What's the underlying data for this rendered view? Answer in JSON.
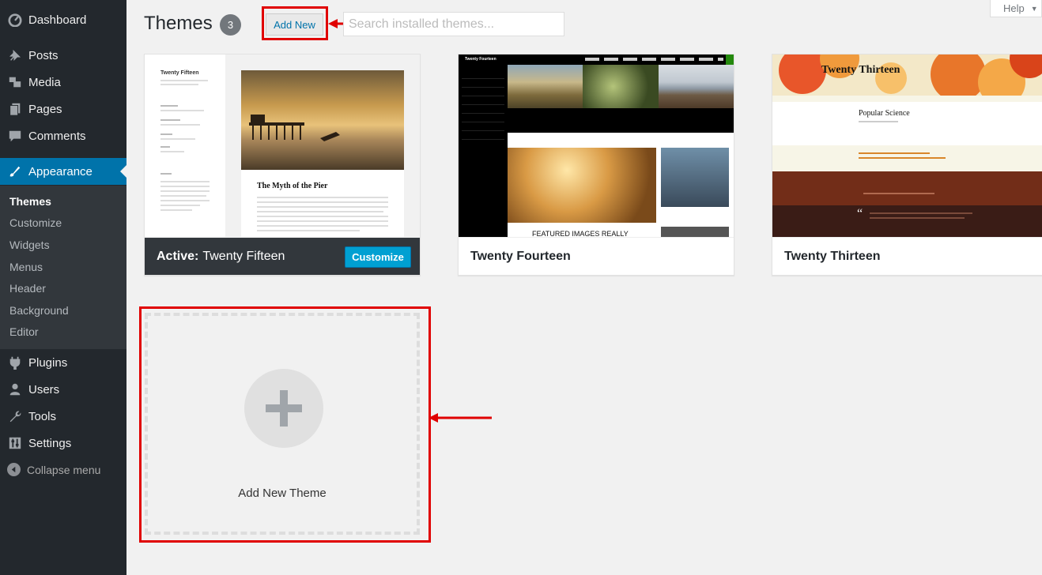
{
  "sidebar": {
    "items": [
      {
        "label": "Dashboard",
        "icon": "dashboard-icon"
      },
      {
        "label": "Posts",
        "icon": "pushpin-icon"
      },
      {
        "label": "Media",
        "icon": "media-icon"
      },
      {
        "label": "Pages",
        "icon": "pages-icon"
      },
      {
        "label": "Comments",
        "icon": "comment-icon"
      },
      {
        "label": "Appearance",
        "icon": "paintbrush-icon"
      },
      {
        "label": "Plugins",
        "icon": "plug-icon"
      },
      {
        "label": "Users",
        "icon": "user-icon"
      },
      {
        "label": "Tools",
        "icon": "wrench-icon"
      },
      {
        "label": "Settings",
        "icon": "settings-sliders-icon"
      }
    ],
    "submenu": [
      "Themes",
      "Customize",
      "Widgets",
      "Menus",
      "Header",
      "Background",
      "Editor"
    ],
    "collapse_label": "Collapse menu"
  },
  "header": {
    "title": "Themes",
    "count": "3",
    "add_new_label": "Add New",
    "search_placeholder": "Search installed themes...",
    "help_label": "Help"
  },
  "themes": [
    {
      "name": "Twenty Fifteen",
      "active_prefix": "Active:",
      "customize_label": "Customize",
      "preview": {
        "site_title": "Twenty Fifteen",
        "post_title": "The Myth of the Pier"
      }
    },
    {
      "name": "Twenty Fourteen",
      "preview": {
        "site_title": "Twenty Fourteen",
        "caption": "FEATURED IMAGES REALLY"
      }
    },
    {
      "name": "Twenty Thirteen",
      "preview": {
        "site_title": "Twenty Thirteen",
        "post_title": "Popular Science"
      }
    }
  ],
  "add_theme": {
    "label": "Add New Theme"
  },
  "colors": {
    "sidebar_bg": "#23282d",
    "accent": "#0073aa",
    "customize_button": "#00a0d2",
    "annotation_red": "#e00000"
  }
}
